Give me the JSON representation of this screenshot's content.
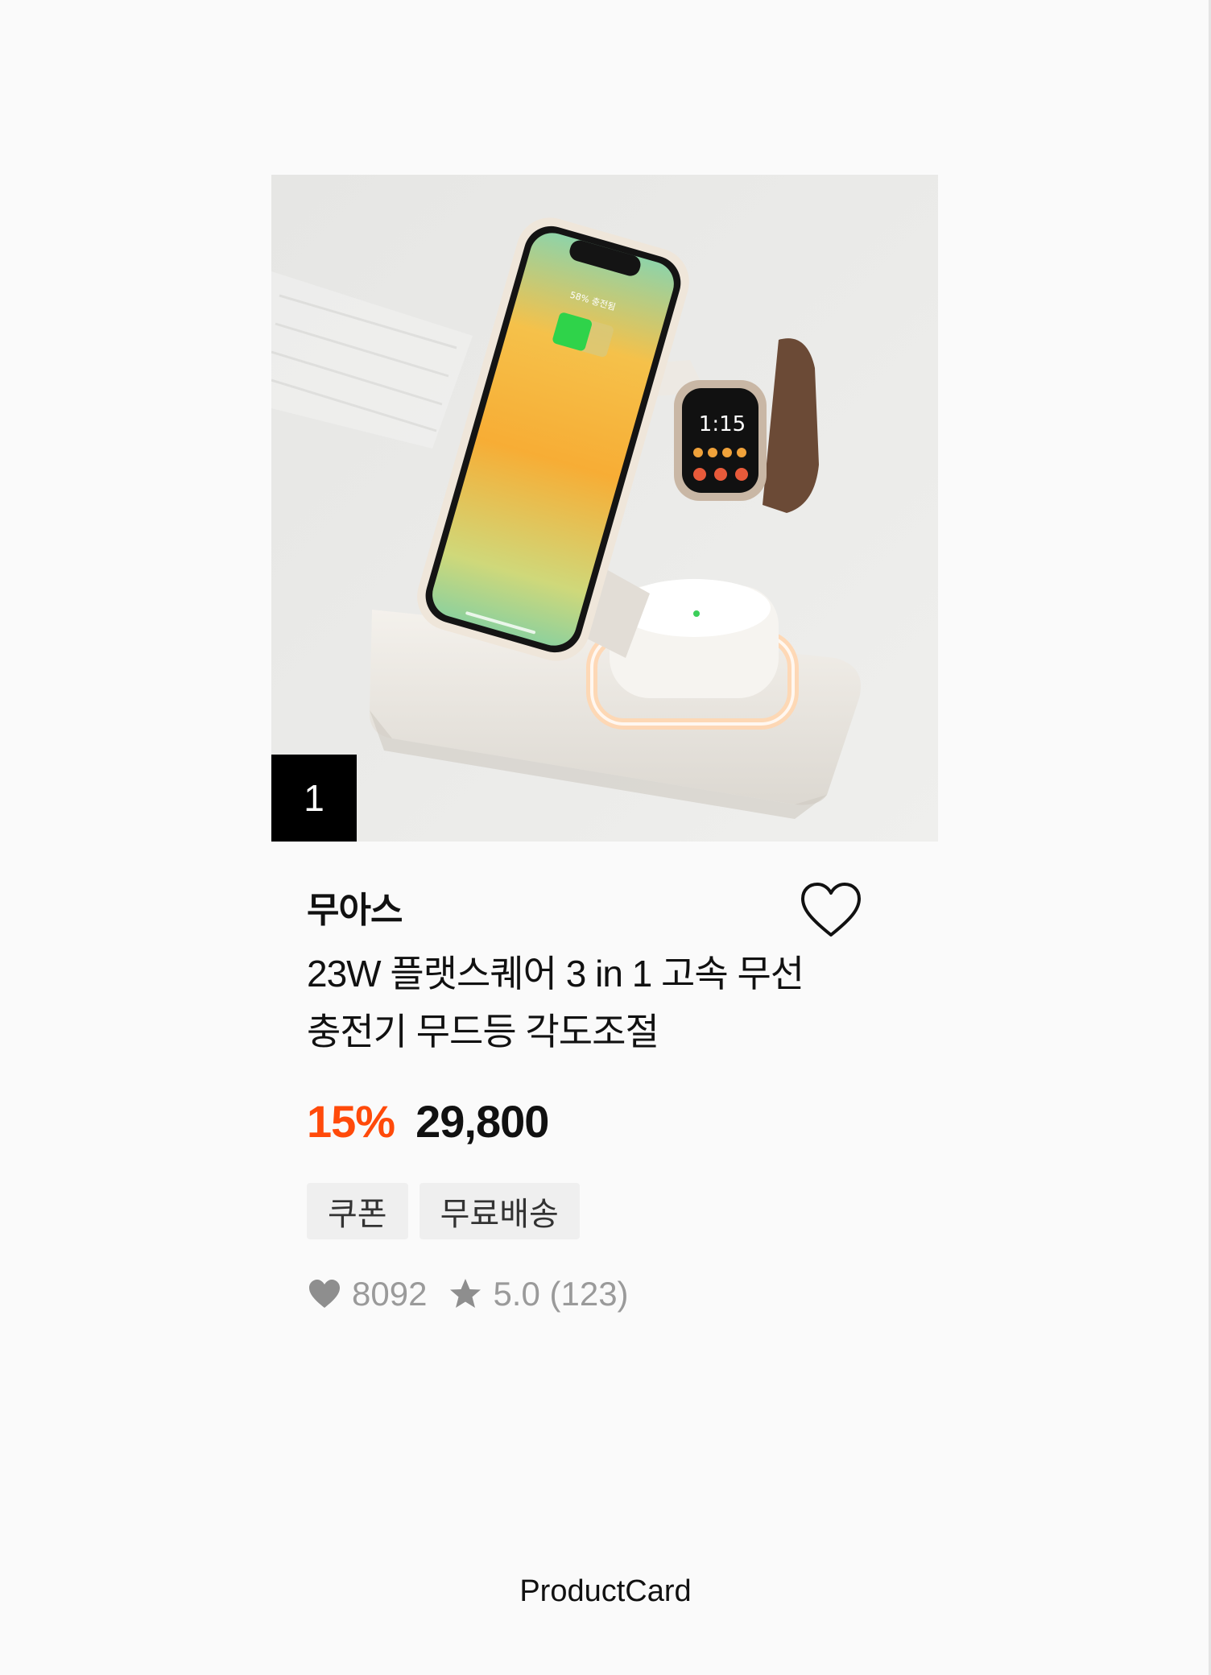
{
  "product": {
    "rank": "1",
    "brand": "무아스",
    "title": "23W 플랫스퀘어 3 in 1 고속 무선충전기 무드등 각도조절",
    "discount": "15%",
    "price": "29,800",
    "tags": [
      "쿠폰",
      "무료배송"
    ],
    "likes": "8092",
    "rating": "5.0 (123)",
    "image_alt": "wireless charger with phone, watch and earbuds",
    "phone_status": "58% 충전됨",
    "watch_time": "1:15"
  },
  "footer": {
    "label": "ProductCard"
  },
  "colors": {
    "discount": "#ff4a0a",
    "badge": "#000000",
    "stat_gray": "#9a9a9a"
  }
}
